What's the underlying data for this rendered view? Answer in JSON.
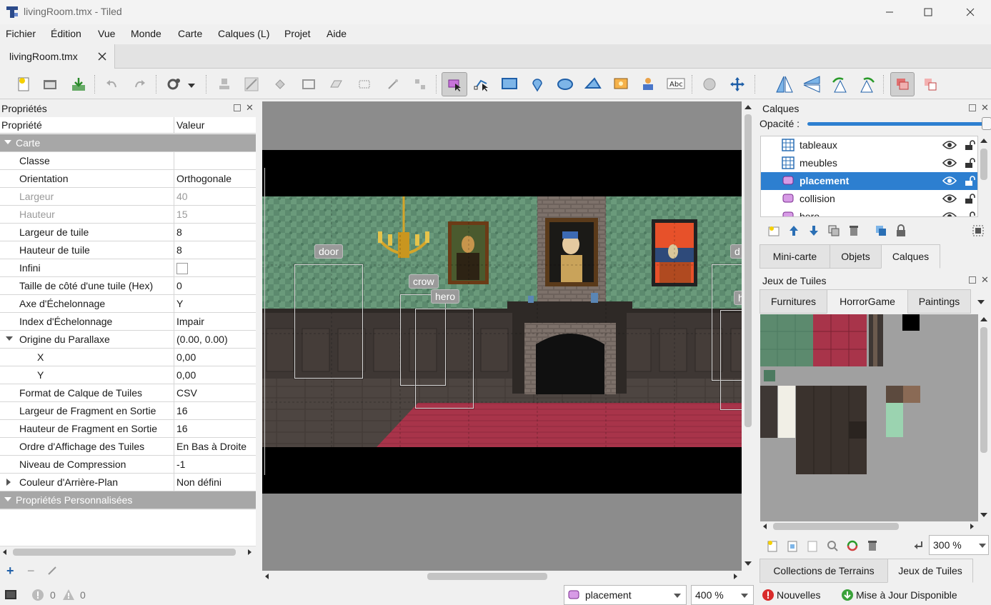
{
  "window": {
    "title": "livingRoom.tmx - Tiled"
  },
  "menu": [
    "Fichier",
    "Édition",
    "Vue",
    "Monde",
    "Carte",
    "Calques (L)",
    "Projet",
    "Aide"
  ],
  "doc_tab": {
    "label": "livingRoom.tmx"
  },
  "toolbar": {
    "file_icons": [
      "new-icon",
      "open-icon",
      "save-icon"
    ],
    "edit_icons": [
      "undo-icon",
      "redo-icon",
      "commands-icon"
    ],
    "tile_tools": [
      "stamp-brush-icon",
      "terrain-brush-icon",
      "bucket-fill-icon",
      "shape-fill-icon",
      "eraser-icon",
      "rectangle-select-icon",
      "magic-wand-icon",
      "select-same-tile-icon"
    ],
    "object_tools": [
      "select-objects-icon",
      "edit-polygons-icon",
      "insert-rectangle-icon",
      "insert-point-icon",
      "insert-ellipse-icon",
      "insert-polygon-icon",
      "insert-tile-icon",
      "insert-template-icon",
      "insert-text-icon"
    ],
    "misc_tools": [
      "world-tool-icon",
      "move-icon"
    ],
    "transform_tools": [
      "flip-horizontal-icon",
      "flip-vertical-icon",
      "rotate-left-icon",
      "rotate-right-icon"
    ],
    "view_tools": [
      "highlight-current-layer-icon",
      "show-tile-collision-icon"
    ]
  },
  "properties": {
    "title": "Propriétés",
    "col_property": "Propriété",
    "col_value": "Valeur",
    "group_map": "Carte",
    "rows": [
      {
        "k": "Classe",
        "v": ""
      },
      {
        "k": "Orientation",
        "v": "Orthogonale"
      },
      {
        "k": "Largeur",
        "v": "40",
        "disabled": true
      },
      {
        "k": "Hauteur",
        "v": "15",
        "disabled": true
      },
      {
        "k": "Largeur de tuile",
        "v": "8"
      },
      {
        "k": "Hauteur de tuile",
        "v": "8"
      },
      {
        "k": "Infini",
        "v": ""
      },
      {
        "k": "Taille de côté d'une tuile (Hex)",
        "v": "0"
      },
      {
        "k": "Axe d'Échelonnage",
        "v": "Y"
      },
      {
        "k": "Index d'Échelonnage",
        "v": "Impair"
      },
      {
        "k": "Origine du Parallaxe",
        "v": "(0.00, 0.00)"
      },
      {
        "k": "X",
        "v": "0,00"
      },
      {
        "k": "Y",
        "v": "0,00"
      },
      {
        "k": "Format de Calque de Tuiles",
        "v": "CSV"
      },
      {
        "k": "Largeur de Fragment en Sortie",
        "v": "16"
      },
      {
        "k": "Hauteur de Fragment en Sortie",
        "v": "16"
      },
      {
        "k": "Ordre d'Affichage des Tuiles",
        "v": "En Bas à Droite"
      },
      {
        "k": "Niveau de Compression",
        "v": "-1"
      },
      {
        "k": "Couleur d'Arrière-Plan",
        "v": "Non défini"
      }
    ],
    "group_custom": "Propriétés Personnalisées",
    "infini_checked": false
  },
  "map_objects": [
    {
      "label": "door"
    },
    {
      "label": "crow"
    },
    {
      "label": "hero"
    },
    {
      "label": "d"
    },
    {
      "label": "h"
    }
  ],
  "layers": {
    "title": "Calques",
    "opacity_label": "Opacité :",
    "opacity": 1.0,
    "items": [
      {
        "name": "tableaux",
        "type": "tile"
      },
      {
        "name": "meubles",
        "type": "tile"
      },
      {
        "name": "placement",
        "type": "object",
        "selected": true
      },
      {
        "name": "collision",
        "type": "object"
      },
      {
        "name": "hero",
        "type": "object"
      }
    ],
    "tabs": [
      "Mini-carte",
      "Objets",
      "Calques"
    ],
    "active_tab": "Calques"
  },
  "tilesets": {
    "title": "Jeux de Tuiles",
    "tabs": [
      "Furnitures",
      "HorrorGame",
      "Paintings"
    ],
    "active_tab": "HorrorGame",
    "zoom": "300 %",
    "bottom_tabs": [
      "Collections de Terrains",
      "Jeux de Tuiles"
    ],
    "bottom_active": "Jeux de Tuiles"
  },
  "status": {
    "errors": "0",
    "warnings": "0",
    "current_layer": "placement",
    "zoom": "400 %",
    "news": "Nouvelles",
    "update": "Mise à Jour Disponible"
  },
  "colors": {
    "selection": "#2d7fd0",
    "group_header": "#a7a7a7",
    "canvas_bg": "#8c8c8c",
    "wall_green": "#5c8a6e",
    "carpet_red": "#a8344a"
  }
}
